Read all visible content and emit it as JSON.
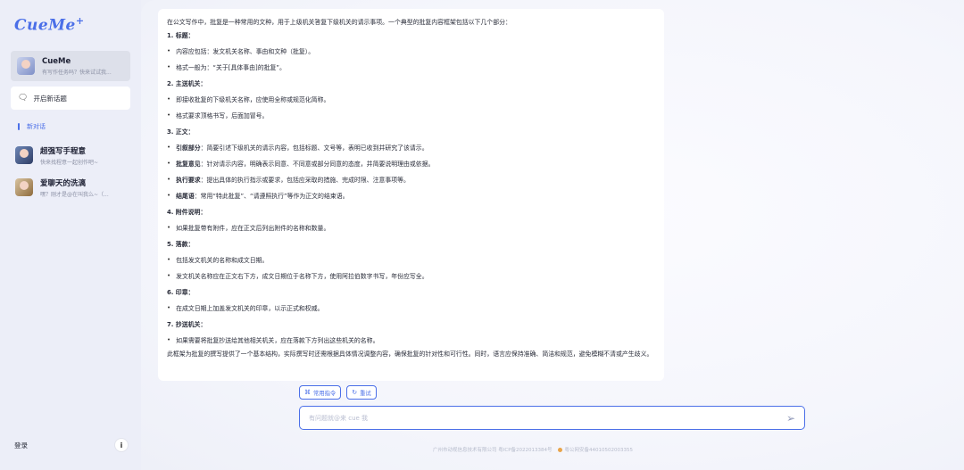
{
  "sidebar": {
    "logo": "CueMe",
    "logo_mark": "+",
    "bot": {
      "name": "CueMe",
      "subtitle": "有写作任务吗？快来试试我..."
    },
    "new_topic_label": "开启新话题",
    "new_chat_label": "新对话",
    "chats": [
      {
        "title": "超强写手程意",
        "subtitle": "快来找程意一起创作吧~"
      },
      {
        "title": "爱聊天的洗漓",
        "subtitle": "嘿？刚才是@在叫我么~（..."
      }
    ],
    "login_label": "登录"
  },
  "message": {
    "intro": "在公文写作中，批复是一种常用的文种，用于上级机关答复下级机关的请示事项。一个典型的批复内容框架包括以下几个部分：",
    "s1": "1. 标题：",
    "s1_b1": "内容应包括：发文机关名称、事由和文种（批复）。",
    "s1_b2": "格式一般为：“关于[具体事由]的批复”。",
    "s2": "2. 主送机关：",
    "s2_b1": "即接收批复的下级机关名称，应使用全称或规范化简称。",
    "s2_b2": "格式要求顶格书写，后面加冒号。",
    "s3": "3. 正文：",
    "s3_b1_label": "引叙部分",
    "s3_b1_text": "：简要引述下级机关的请示内容，包括标题、文号等，表明已收到并研究了该请示。",
    "s3_b2_label": "批复意见",
    "s3_b2_text": "：针对请示内容，明确表示同意、不同意或部分同意的态度，并简要说明理由或依据。",
    "s3_b3_label": "执行要求",
    "s3_b3_text": "：提出具体的执行指示或要求，包括应采取的措施、完成时限、注意事项等。",
    "s3_b4_label": "结尾语",
    "s3_b4_text": "：常用“特此批复”、“请遵照执行”等作为正文的结束语。",
    "s4": "4. 附件说明：",
    "s4_b1": "如果批复带有附件，应在正文后列出附件的名称和数量。",
    "s5": "5. 落款：",
    "s5_b1": "包括发文机关的名称和成文日期。",
    "s5_b2": "发文机关名称应在正文右下方，成文日期位于名称下方，使用阿拉伯数字书写，年份应写全。",
    "s6": "6. 印章：",
    "s6_b1": "在成文日期上加盖发文机关的印章，以示正式和权威。",
    "s7": "7. 抄送机关：",
    "s7_b1": "如果需要将批复抄送给其他相关机关，应在落款下方列出这些机关的名称。",
    "closing": "此框架为批复的撰写提供了一个基本结构，实际撰写时还需根据具体情况调整内容，确保批复的针对性和可行性。同时，语言应保持准确、简洁和规范，避免模糊不清或产生歧义。"
  },
  "actions": {
    "common_cmd": "常用指令",
    "retry": "重试"
  },
  "input": {
    "placeholder": "有问题就@来 cue 我"
  },
  "footer": {
    "icp": "广州市动视信息技术有限公司 粤ICP备2022013384号",
    "police": "粤公网安备44010502003355"
  },
  "colors": {
    "accent": "#4b6fe8",
    "sidebar_bg": "#eceef8"
  },
  "icons": {
    "new_topic": "chat-bubble-icon",
    "send": "paper-plane-icon",
    "info": "info-circle-icon",
    "retry": "refresh-icon",
    "command": "command-icon"
  }
}
